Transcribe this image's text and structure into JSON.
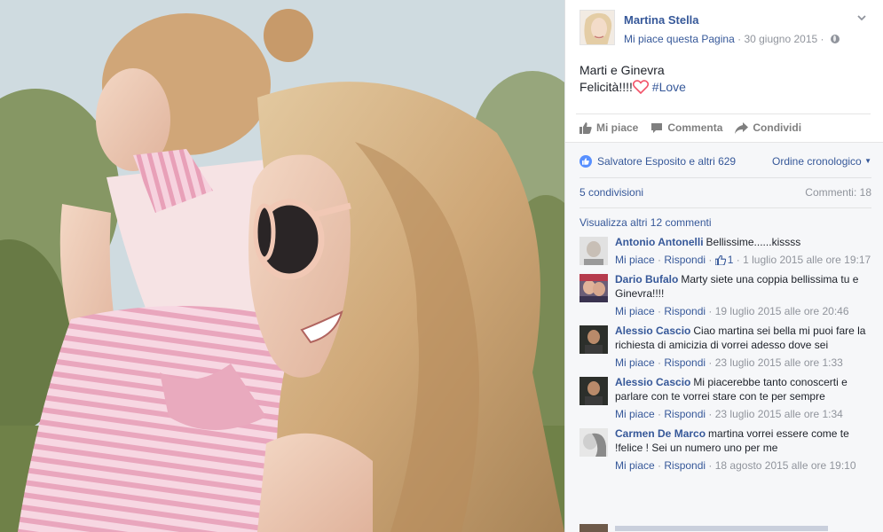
{
  "post": {
    "page_name": "Martina Stella",
    "like_page": "Mi piace questa Pagina",
    "separator": "·",
    "date": "30 giugno 2015",
    "text_line1": "Marti e Ginevra",
    "text_line2_prefix": "Felicità!!!!",
    "hashtag": "#Love"
  },
  "actions": {
    "like": "Mi piace",
    "comment": "Commenta",
    "share": "Condividi"
  },
  "reactions": {
    "likers": "Salvatore Esposito e altri 629",
    "order": "Ordine cronologico",
    "shares": "5 condivisioni",
    "comments_count": "Commenti: 18",
    "view_more": "Visualizza altri 12 commenti"
  },
  "comments": [
    {
      "author": "Antonio Antonelli",
      "text": "Bellissime......kissss",
      "like": "Mi piace",
      "reply": "Rispondi",
      "likes": "1",
      "time": "1 luglio 2015 alle ore 19:17"
    },
    {
      "author": "Dario Bufalo",
      "text": "Marty siete una coppia bellissima tu e Ginevra!!!!",
      "like": "Mi piace",
      "reply": "Rispondi",
      "time": "19 luglio 2015 alle ore 20:46"
    },
    {
      "author": "Alessio Cascio",
      "text": "Ciao martina sei bella mi puoi fare la richiesta di amicizia di vorrei adesso dove sei",
      "like": "Mi piace",
      "reply": "Rispondi",
      "time": "23 luglio 2015 alle ore 1:33"
    },
    {
      "author": "Alessio Cascio",
      "text": "Mi piacerebbe tanto conoscerti e parlare con te vorrei stare con te per sempre",
      "like": "Mi piace",
      "reply": "Rispondi",
      "time": "23 luglio 2015 alle ore 1:34"
    },
    {
      "author": "Carmen De Marco",
      "text": "martina vorrei essere come te !felice ! Sei un numero uno per me",
      "like": "Mi piace",
      "reply": "Rispondi",
      "time": "18 agosto 2015 alle ore 19:10"
    }
  ],
  "colors": {
    "link": "#365899",
    "meta": "#90949c",
    "feedback_bg": "#f6f7f9",
    "heart": "#f25268"
  },
  "icons": [
    "chevron-down-icon",
    "globe-icon",
    "heart-icon",
    "like-icon",
    "comment-icon",
    "share-icon",
    "like-badge-icon",
    "thumb-mini-icon"
  ]
}
